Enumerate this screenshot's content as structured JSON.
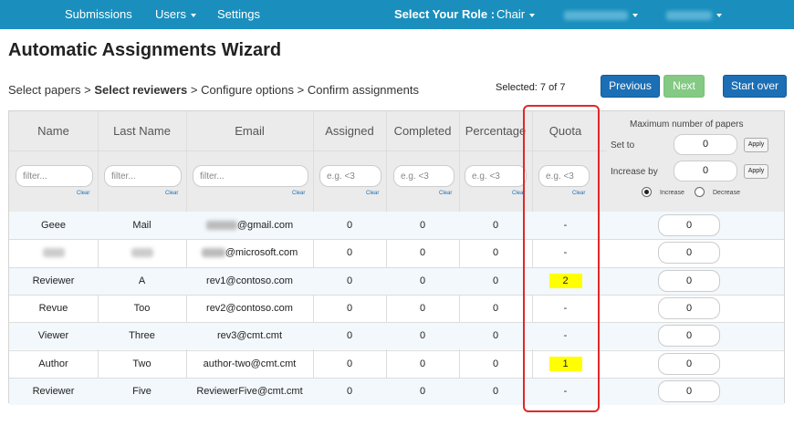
{
  "nav": {
    "submissions": "Submissions",
    "users": "Users",
    "settings": "Settings",
    "role_label": "Select Your Role :",
    "role_value": "Chair"
  },
  "page_title": "Automatic Assignments Wizard",
  "wizard_steps": {
    "step1": "Select papers",
    "step2": "Select reviewers",
    "step3": "Configure options",
    "step4": "Confirm assignments",
    "separator": ">"
  },
  "selected_text": "Selected: 7 of 7",
  "buttons": {
    "previous": "Previous",
    "next": "Next",
    "start_over": "Start over"
  },
  "columns": {
    "name": "Name",
    "last_name": "Last Name",
    "email": "Email",
    "assigned": "Assigned",
    "completed": "Completed",
    "percentage": "Percentage",
    "quota": "Quota"
  },
  "filters": {
    "text_placeholder": "filter...",
    "num_placeholder": "e.g. <3",
    "clear_label": "Clear"
  },
  "max_panel": {
    "title": "Maximum number of papers",
    "set_to_label": "Set to",
    "set_to_value": "0",
    "increase_by_label": "Increase by",
    "increase_by_value": "0",
    "apply_label": "Apply",
    "increase_label": "Increase",
    "decrease_label": "Decrease",
    "mode_selected": "Increase"
  },
  "rows": [
    {
      "name": "Geee",
      "last_name": "Mail",
      "email": "@gmail.com",
      "assigned": "0",
      "completed": "0",
      "percentage": "0",
      "quota": "-",
      "max": "0"
    },
    {
      "name": "",
      "last_name": "",
      "email": "@microsoft.com",
      "assigned": "0",
      "completed": "0",
      "percentage": "0",
      "quota": "-",
      "max": "0"
    },
    {
      "name": "Reviewer",
      "last_name": "A",
      "email": "rev1@contoso.com",
      "assigned": "0",
      "completed": "0",
      "percentage": "0",
      "quota": "2",
      "max": "0"
    },
    {
      "name": "Revue",
      "last_name": "Too",
      "email": "rev2@contoso.com",
      "assigned": "0",
      "completed": "0",
      "percentage": "0",
      "quota": "-",
      "max": "0"
    },
    {
      "name": "Viewer",
      "last_name": "Three",
      "email": "rev3@cmt.cmt",
      "assigned": "0",
      "completed": "0",
      "percentage": "0",
      "quota": "-",
      "max": "0"
    },
    {
      "name": "Author",
      "last_name": "Two",
      "email": "author-two@cmt.cmt",
      "assigned": "0",
      "completed": "0",
      "percentage": "0",
      "quota": "1",
      "max": "0"
    },
    {
      "name": "Reviewer",
      "last_name": "Five",
      "email": "ReviewerFive@cmt.cmt",
      "assigned": "0",
      "completed": "0",
      "percentage": "0",
      "quota": "-",
      "max": "0"
    }
  ],
  "colors": {
    "navbar": "#1a8fbd",
    "primary_button": "#1c6fb5",
    "next_button": "#5cb85c",
    "quota_highlight": "#ffff00",
    "annotation_box": "#e0282a"
  }
}
